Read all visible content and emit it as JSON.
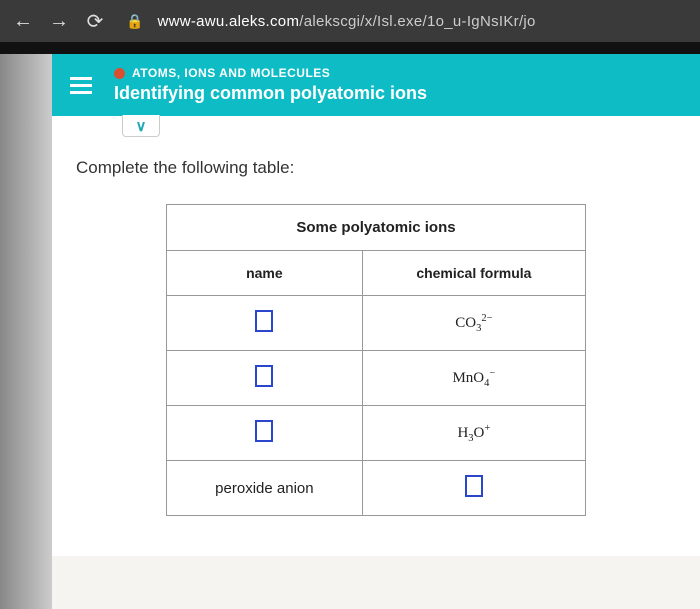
{
  "browser": {
    "url_domain": "www-awu.aleks.com",
    "url_path": "/alekscgi/x/Isl.exe/1o_u-IgNsIKr/jo"
  },
  "header": {
    "course_label": "ATOMS, IONS AND MOLECULES",
    "course_title": "Identifying common polyatomic ions"
  },
  "content": {
    "instruction": "Complete the following table:",
    "table_title": "Some polyatomic ions",
    "col_name": "name",
    "col_formula": "chemical formula",
    "rows": [
      {
        "name": "",
        "formula_base": "CO",
        "formula_sub": "3",
        "formula_sup": "2−",
        "name_input": true,
        "formula_input": false
      },
      {
        "name": "",
        "formula_base": "MnO",
        "formula_sub": "4",
        "formula_sup": "−",
        "name_input": true,
        "formula_input": false
      },
      {
        "name": "",
        "formula_base": "H",
        "formula_sub": "3",
        "formula_tail": "O",
        "formula_sup": "+",
        "name_input": true,
        "formula_input": false
      },
      {
        "name": "peroxide anion",
        "formula_base": "",
        "formula_sub": "",
        "formula_sup": "",
        "name_input": false,
        "formula_input": true
      }
    ]
  }
}
